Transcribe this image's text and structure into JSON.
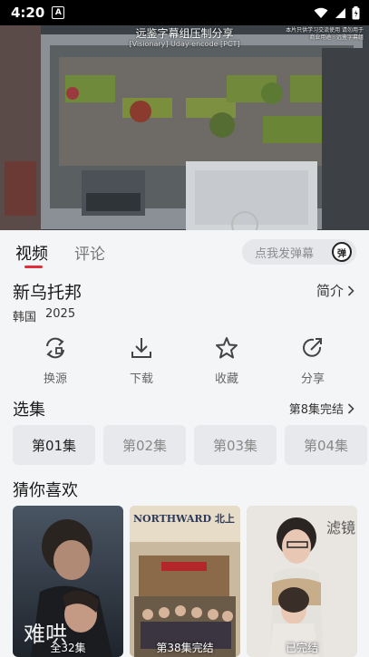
{
  "status_bar": {
    "time": "4:20",
    "notification_icon": "A"
  },
  "video": {
    "subtitle_main": "远鉴字幕组压制分享",
    "subtitle_credit": "[Visionary] Uday encode [PCT]",
    "watermark": "本片只供学习交流使用 请勿用于商业用途 · 远鉴字幕组"
  },
  "tabs": [
    {
      "label": "视频"
    },
    {
      "label": "评论"
    }
  ],
  "danmaku": {
    "placeholder": "点我发弹幕",
    "button_label": "弹"
  },
  "show": {
    "title": "新乌托邦",
    "intro_label": "简介",
    "region": "韩国",
    "year": "2025"
  },
  "actions": [
    {
      "label": "换源",
      "icon": "switch-source-icon"
    },
    {
      "label": "下载",
      "icon": "download-icon"
    },
    {
      "label": "收藏",
      "icon": "star-icon"
    },
    {
      "label": "分享",
      "icon": "share-icon"
    }
  ],
  "episodes_section": {
    "title": "选集",
    "status": "第8集完结",
    "items": [
      {
        "label": "第01集"
      },
      {
        "label": "第02集"
      },
      {
        "label": "第03集"
      },
      {
        "label": "第04集"
      }
    ],
    "selected_index": 0
  },
  "recommend_section": {
    "title": "猜你喜欢",
    "items": [
      {
        "caption": "全32集",
        "poster_text": "难哄"
      },
      {
        "caption": "第38集完结",
        "poster_text": "NORTHWARD 北上"
      },
      {
        "caption": "已完结",
        "poster_text": "滤镜"
      }
    ]
  },
  "colors": {
    "accent": "#e02e3c",
    "background": "#f4f5f7",
    "chip": "#e8e9ec"
  }
}
